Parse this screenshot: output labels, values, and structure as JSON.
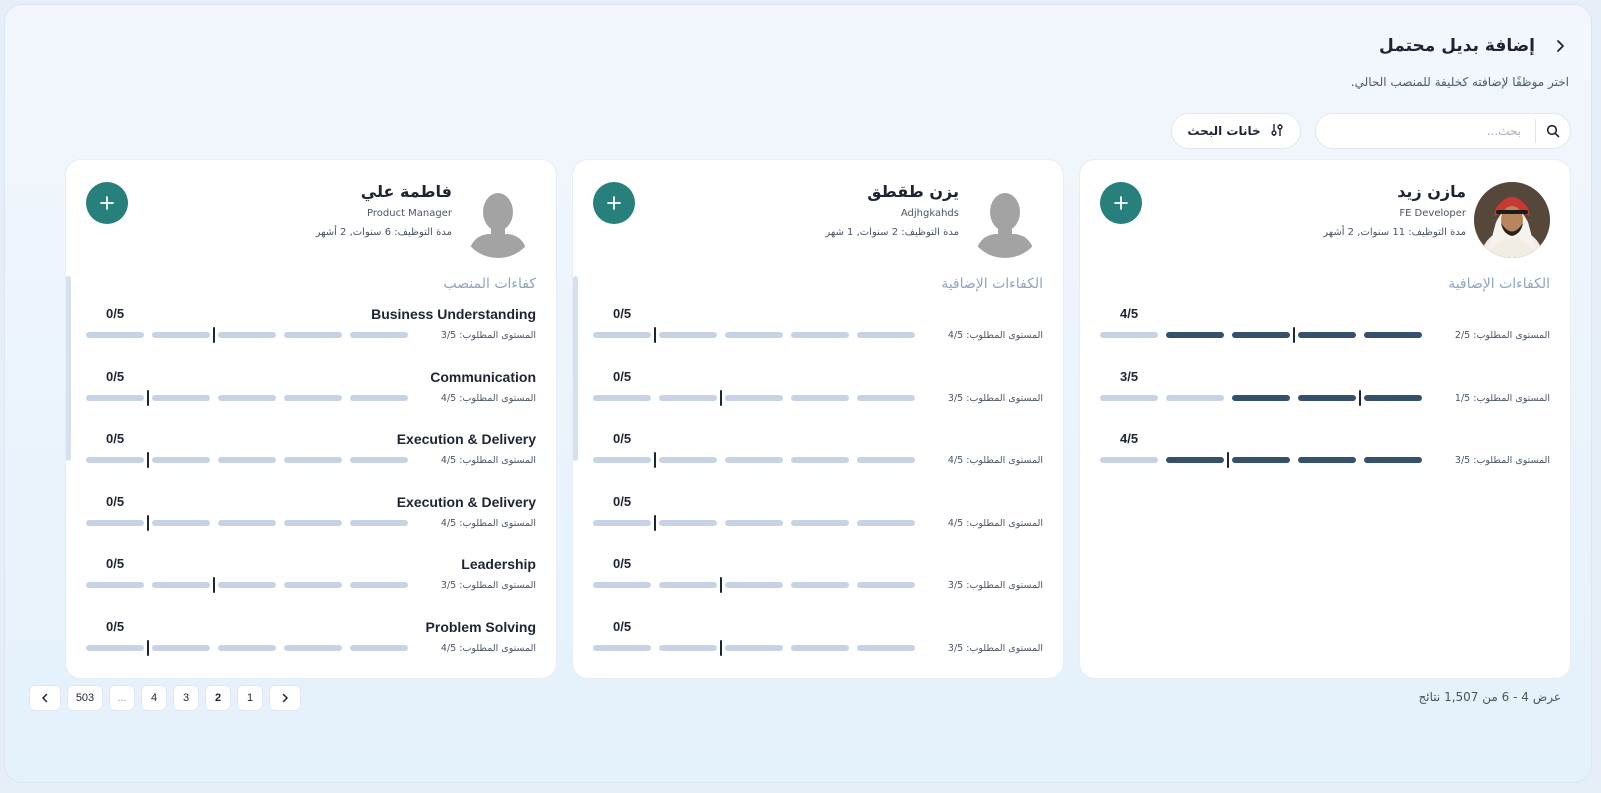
{
  "header": {
    "title": "إضافة بديل محتمل",
    "subtitle": "اختر موظفًا لإضافته كخليفة للمنصب الحالي."
  },
  "search": {
    "placeholder": "بحث...",
    "filter_label": "خانات البحث"
  },
  "cards": [
    {
      "name": "مازن زيد",
      "role": "FE Developer",
      "tenure": "مدة التوظيف: 11 سنوات, 2 أشهر",
      "avatar": "photo",
      "section": "الكفاءات الإضافية",
      "competencies": [
        {
          "name": "",
          "score": "4/5",
          "level": 4,
          "required": 2,
          "required_label": "المستوى المطلوب: 2/5"
        },
        {
          "name": "",
          "score": "3/5",
          "level": 3,
          "required": 1,
          "required_label": "المستوى المطلوب: 1/5"
        },
        {
          "name": "",
          "score": "4/5",
          "level": 4,
          "required": 3,
          "required_label": "المستوى المطلوب: 3/5"
        }
      ]
    },
    {
      "name": "يزن طقطق",
      "role": "Adjhgkahds",
      "tenure": "مدة التوظيف: 2 سنوات, 1 شهر",
      "avatar": "placeholder",
      "section": "الكفاءات الإضافية",
      "competencies": [
        {
          "name": "",
          "score": "0/5",
          "level": 0,
          "required": 4,
          "required_label": "المستوى المطلوب: 4/5"
        },
        {
          "name": "",
          "score": "0/5",
          "level": 0,
          "required": 3,
          "required_label": "المستوى المطلوب: 3/5"
        },
        {
          "name": "",
          "score": "0/5",
          "level": 0,
          "required": 4,
          "required_label": "المستوى المطلوب: 4/5"
        },
        {
          "name": "",
          "score": "0/5",
          "level": 0,
          "required": 4,
          "required_label": "المستوى المطلوب: 4/5"
        },
        {
          "name": "",
          "score": "0/5",
          "level": 0,
          "required": 3,
          "required_label": "المستوى المطلوب: 3/5"
        },
        {
          "name": "",
          "score": "0/5",
          "level": 0,
          "required": 3,
          "required_label": "المستوى المطلوب: 3/5"
        }
      ]
    },
    {
      "name": "فاطمة علي",
      "role": "Product Manager",
      "tenure": "مدة التوظيف: 6 سنوات, 2 أشهر",
      "avatar": "placeholder",
      "section": "كفاءات المنصب",
      "competencies": [
        {
          "name": "Business Understanding",
          "score": "0/5",
          "level": 0,
          "required": 3,
          "required_label": "المستوى المطلوب: 3/5"
        },
        {
          "name": "Communication",
          "score": "0/5",
          "level": 0,
          "required": 4,
          "required_label": "المستوى المطلوب: 4/5"
        },
        {
          "name": "Execution & Delivery",
          "score": "0/5",
          "level": 0,
          "required": 4,
          "required_label": "المستوى المطلوب: 4/5"
        },
        {
          "name": "Execution & Delivery",
          "score": "0/5",
          "level": 0,
          "required": 4,
          "required_label": "المستوى المطلوب: 4/5"
        },
        {
          "name": "Leadership",
          "score": "0/5",
          "level": 0,
          "required": 3,
          "required_label": "المستوى المطلوب: 3/5"
        },
        {
          "name": "Problem Solving",
          "score": "0/5",
          "level": 0,
          "required": 4,
          "required_label": "المستوى المطلوب: 4/5"
        }
      ]
    }
  ],
  "pagination": {
    "pages": [
      "1",
      "2",
      "3",
      "4",
      "...",
      "503"
    ],
    "current": "2"
  },
  "results_text": "عرض 4 - 6 من 1,507 نتائج",
  "colors": {
    "accent": "#27807b",
    "filled_bar": "#35506b",
    "empty_bar": "#c7d3e5"
  }
}
